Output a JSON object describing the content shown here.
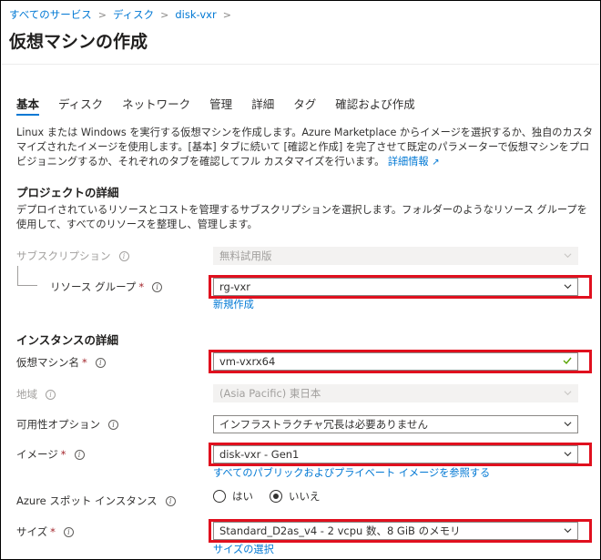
{
  "breadcrumb": [
    "すべてのサービス",
    "ディスク",
    "disk-vxr"
  ],
  "page_title": "仮想マシンの作成",
  "tabs": [
    "基本",
    "ディスク",
    "ネットワーク",
    "管理",
    "詳細",
    "タグ",
    "確認および作成"
  ],
  "active_tab": "基本",
  "intro": {
    "text": "Linux または Windows を実行する仮想マシンを作成します。Azure Marketplace からイメージを選択するか、独自のカスタマイズされたイメージを使用します。[基本] タブに続いて [確認と作成] を完了させて既定のパラメーターで仮想マシンをプロビジョニングするか、それぞれのタブを確認してフル カスタマイズを行います。",
    "link": "詳細情報"
  },
  "project": {
    "title": "プロジェクトの詳細",
    "desc": "デプロイされているリソースとコストを管理するサブスクリプションを選択します。フォルダーのようなリソース グループを使用して、すべてのリソースを整理し、管理します。",
    "subscription_label": "サブスクリプション",
    "subscription_value": "無料試用版",
    "rg_label": "リソース グループ",
    "rg_value": "rg-vxr",
    "rg_new": "新規作成"
  },
  "instance": {
    "title": "インスタンスの詳細",
    "vm_name_label": "仮想マシン名",
    "vm_name_value": "vm-vxrx64",
    "region_label": "地域",
    "region_value": "(Asia Pacific) 東日本",
    "availability_label": "可用性オプション",
    "availability_value": "インフラストラクチャ冗長は必要ありません",
    "image_label": "イメージ",
    "image_value": "disk-vxr - Gen1",
    "image_link": "すべてのパブリックおよびプライベート イメージを参照する",
    "spot_label": "Azure スポット インスタンス",
    "spot_yes": "はい",
    "spot_no": "いいえ",
    "spot_selected": "いいえ",
    "size_label": "サイズ",
    "size_value": "Standard_D2as_v4 - 2 vcpu 数、8 GiB のメモリ",
    "size_link": "サイズの選択"
  },
  "colors": {
    "accent": "#0078d4",
    "highlight": "#e0101e",
    "required": "#a4262c",
    "valid": "#57a300"
  },
  "icons": {
    "info": "info-icon",
    "chevron": "chevron-down-icon",
    "check": "checkmark-icon",
    "external": "external-link-icon"
  }
}
